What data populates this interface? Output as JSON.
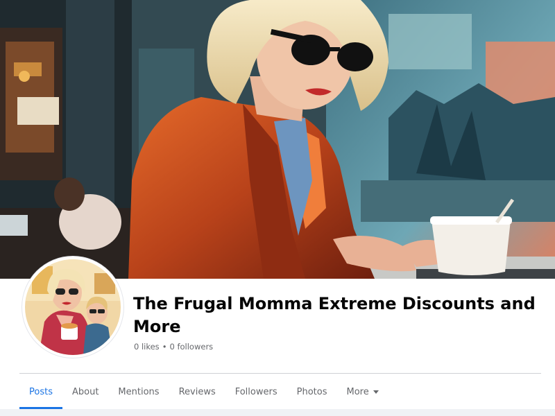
{
  "page": {
    "title": "The Frugal Momma Extreme Discounts and More",
    "likes": "0 likes",
    "separator": "•",
    "followers": "0 followers"
  },
  "tabs": [
    {
      "label": "Posts",
      "active": true
    },
    {
      "label": "About",
      "active": false
    },
    {
      "label": "Mentions",
      "active": false
    },
    {
      "label": "Reviews",
      "active": false
    },
    {
      "label": "Followers",
      "active": false
    },
    {
      "label": "Photos",
      "active": false
    },
    {
      "label": "More",
      "active": false
    }
  ],
  "icons": {
    "more_dropdown": "chevron-down-icon"
  },
  "colors": {
    "accent": "#1b74e4",
    "muted_text": "#65676b",
    "title_text": "#050505"
  }
}
